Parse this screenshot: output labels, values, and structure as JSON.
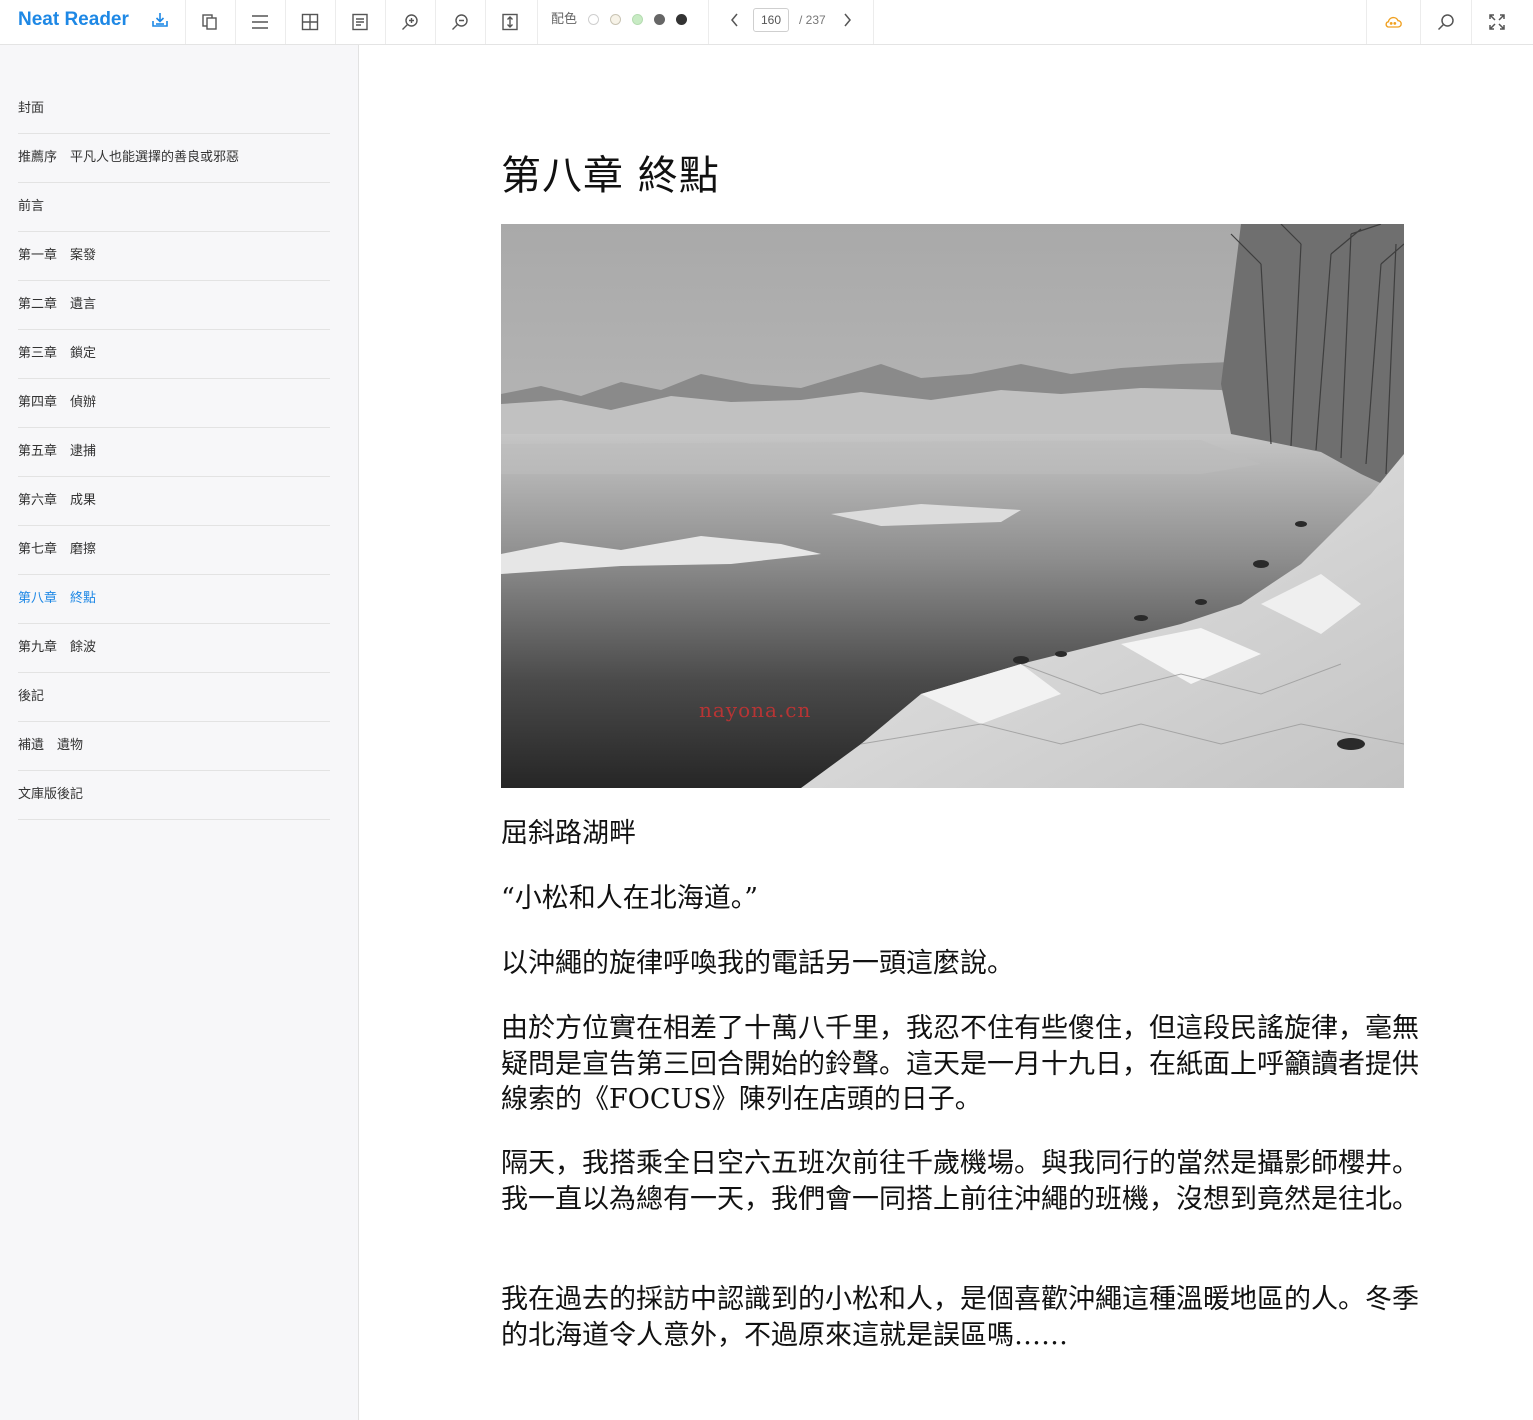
{
  "app": {
    "name": "Neat Reader",
    "colors": {
      "brand": "#1e88e5",
      "active_toc": "#1e88e5"
    }
  },
  "toolbar": {
    "icons": [
      "download-icon",
      "copy-icon",
      "menu-icon",
      "grid-icon",
      "notes-icon",
      "zoom-in-icon",
      "zoom-out-icon",
      "fit-height-icon"
    ],
    "palette_label": "配色",
    "palette": [
      "#ffffff",
      "#f7f3e8",
      "#c8ebc4",
      "#666666",
      "#333333"
    ],
    "page_current": "160",
    "page_total": "/ 237",
    "right_icons": [
      "cloud-icon",
      "search-icon",
      "fullscreen-icon"
    ]
  },
  "toc": [
    {
      "label": "封面",
      "active": false
    },
    {
      "label": "推薦序　平凡人也能選擇的善良或邪惡",
      "active": false
    },
    {
      "label": "前言",
      "active": false
    },
    {
      "label": "第一章　案發",
      "active": false
    },
    {
      "label": "第二章　遺言",
      "active": false
    },
    {
      "label": "第三章　鎖定",
      "active": false
    },
    {
      "label": "第四章　偵辦",
      "active": false
    },
    {
      "label": "第五章　逮捕",
      "active": false
    },
    {
      "label": "第六章　成果",
      "active": false
    },
    {
      "label": "第七章　磨擦",
      "active": false
    },
    {
      "label": "第八章　終點",
      "active": true
    },
    {
      "label": "第九章　餘波",
      "active": false
    },
    {
      "label": "後記",
      "active": false
    },
    {
      "label": "補遺　遺物",
      "active": false
    },
    {
      "label": "文庫版後記",
      "active": false
    }
  ],
  "content": {
    "chapter_title": "第八章 終點",
    "watermark": "nayona.cn",
    "paragraphs": [
      "屈斜路湖畔",
      "“小松和人在北海道。”",
      "以沖繩的旋律呼喚我的電話另一頭這麼說。",
      "由於方位實在相差了十萬八千里，我忍不住有些傻住，但這段民謠旋律，毫無疑問是宣告第三回合開始的鈴聲。這天是一月十九日，在紙面上呼籲讀者提供線索的《FOCUS》陳列在店頭的日子。",
      "隔天，我搭乘全日空六五班次前往千歲機場。與我同行的當然是攝影師櫻井。我一直以為總有一天，我們會一同搭上前往沖繩的班機，沒想到竟然是往北。",
      "我在過去的採訪中認識到的小松和人，是個喜歡沖繩這種溫暖地區的人。冬季的北海道令人意外，不過原來這就是誤區嗎……"
    ]
  }
}
